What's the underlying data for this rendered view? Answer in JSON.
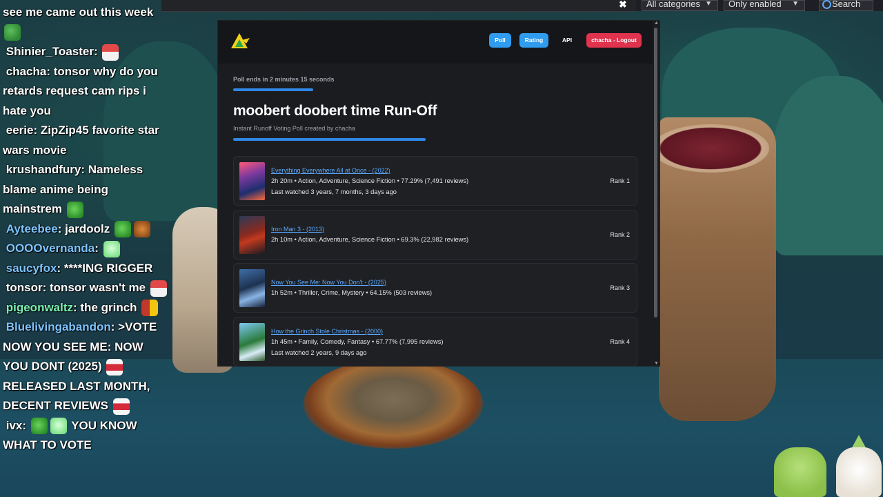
{
  "topbar": {
    "categories_value": "All categories",
    "enabled_value": "Only enabled",
    "search_label": "Search",
    "clear_glyph": "✖"
  },
  "chat": {
    "messages": [
      {
        "text": "see me came out this week",
        "emotes": [
          "frog"
        ]
      },
      {
        "user": "Shinier_Toaster",
        "text": ":",
        "user_color": "#ffffff",
        "emotes": [
          "santa"
        ]
      },
      {
        "user": "chacha",
        "text": ": tonsor why do you retards request cam rips i hate you",
        "user_color": "#ffffff"
      },
      {
        "user": "eerie",
        "text": ": ZipZip45 favorite star wars movie",
        "user_color": "#ffffff"
      },
      {
        "user": "krushandfury",
        "text": ": Nameless blame anime being mainstrem",
        "user_color": "#ffffff",
        "emotes": [
          "grinch"
        ]
      },
      {
        "user": "Ayteebee",
        "text": ": jardoolz",
        "user_color": "#7ec4ff",
        "emotes": [
          "grinch",
          "fox"
        ]
      },
      {
        "user": "OOOOvernanda",
        "text": ":",
        "user_color": "#7ec4ff",
        "emotes": [
          "ghost"
        ]
      },
      {
        "user": "saucyfox",
        "text": ": ****ING RIGGER",
        "user_color": "#7ec4ff",
        "emotes": [
          "fox",
          "mouth"
        ]
      },
      {
        "user": "tonsor",
        "text": ": tonsor wasn't me",
        "user_color": "#ffffff",
        "emotes": [
          "santa"
        ]
      },
      {
        "user": "pigeonwaltz",
        "text": ": the grinch",
        "user_color": "#7cf0b0",
        "emotes": [
          "cny"
        ]
      },
      {
        "user": "Bluelivingabandon",
        "text": ": >VOTE NOW YOU SEE ME: NOW YOU DONT (2025)",
        "user_color": "#7ec4ff",
        "emotes": [
          "mouth"
        ],
        "text2": " RELEASED LAST MONTH, DECENT REVIEWS",
        "emotes2": [
          "mouth"
        ]
      },
      {
        "user": "ivx",
        "text": ":",
        "user_color": "#ffffff",
        "emotes": [
          "grinch",
          "ghost"
        ],
        "text2": " YOU KNOW WHAT TO VOTE"
      }
    ]
  },
  "nav": {
    "poll": "Poll",
    "rating": "Rating",
    "api": "API",
    "logout": "chacha - Logout"
  },
  "poll": {
    "ends": "Poll ends in 2 minutes 15 seconds",
    "title": "moobert doobert time Run-Off",
    "subtitle": "Instant Runoff Voting Poll created by chacha",
    "items": [
      {
        "name": "Everything Everywhere All at Once - (2022)",
        "meta": "2h 20m • Action, Adventure, Science Fiction • 77.29% (7,491 reviews)",
        "watched": "Last watched 3 years, 7 months, 3 days ago",
        "rank": "Rank 1"
      },
      {
        "name": "Iron Man 3 - (2013)",
        "meta": "2h 10m • Action, Adventure, Science Fiction • 69.3% (22,982 reviews)",
        "watched": "",
        "rank": "Rank 2"
      },
      {
        "name": "Now You See Me: Now You Don't - (2025)",
        "meta": "1h 52m • Thriller, Crime, Mystery • 64.15% (503 reviews)",
        "watched": "",
        "rank": "Rank 3"
      },
      {
        "name": "How the Grinch Stole Christmas - (2000)",
        "meta": "1h 45m • Family, Comedy, Fantasy • 67.77% (7,995 reviews)",
        "watched": "Last watched 2 years, 9 days ago",
        "rank": "Rank 4"
      }
    ]
  },
  "colors": {
    "primary": "#2f9cf0",
    "danger": "#e0334e",
    "link": "#5aa9ff",
    "panel": "#1b1c20"
  }
}
